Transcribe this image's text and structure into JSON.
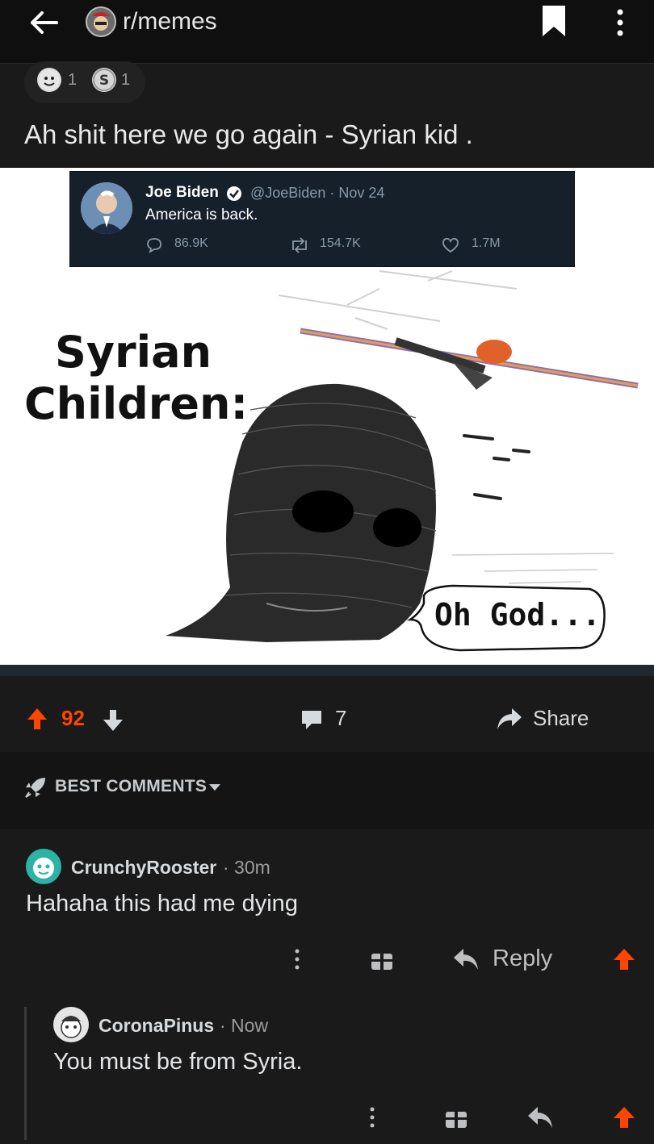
{
  "header": {
    "subreddit": "r/memes",
    "icons": [
      "back-arrow-icon",
      "subreddit-avatar",
      "bookmark-icon",
      "more-vert-icon"
    ]
  },
  "post": {
    "awards": [
      {
        "icon": "award-icon",
        "count": "1"
      },
      {
        "icon": "silver-coin-icon",
        "count": "1"
      }
    ],
    "title": "Ah shit here we go again - Syrian kid .",
    "image": {
      "tweet": {
        "name": "Joe Biden",
        "handle": "@JoeBiden · Nov 24",
        "text": "America is back.",
        "replies": "86.9K",
        "retweets": "154.7K",
        "likes": "1.7M"
      },
      "caption_line1": "Syrian",
      "caption_line2": "Children:",
      "speech": "Oh God..."
    },
    "votes": "92",
    "comments": "7",
    "share_label": "Share"
  },
  "sort": {
    "label": "BEST COMMENTS"
  },
  "comments": [
    {
      "user": "CrunchyRooster",
      "time": "· 30m",
      "body": "Hahaha this had me dying",
      "reply_label": "Reply"
    },
    {
      "user": "CoronaPinus",
      "time": "· Now",
      "body": "You must be from Syria."
    }
  ],
  "colors": {
    "accent": "#ff4500",
    "background": "#1a1a1b"
  }
}
